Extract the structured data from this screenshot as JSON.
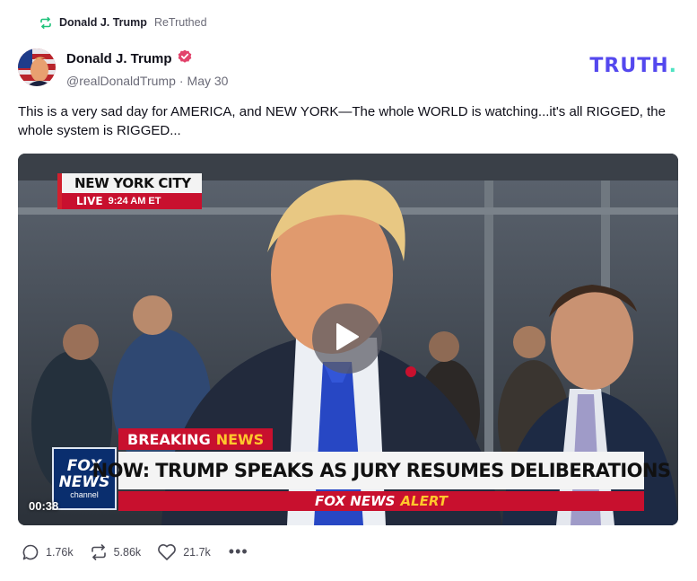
{
  "retruth": {
    "name": "Donald J. Trump",
    "label": "ReTruthed"
  },
  "post": {
    "author_name": "Donald J. Trump",
    "handle": "@realDonaldTrump",
    "separator": "·",
    "date": "May 30",
    "text": "This is a very sad day for AMERICA, and NEW YORK—The whole WORLD is watching...it's all RIGGED, the whole system is RIGGED..."
  },
  "brand": {
    "main": "TRUTH",
    "dot": "."
  },
  "video": {
    "duration": "00:38",
    "location_tag": "NEW YORK CITY",
    "live_label": "LIVE",
    "live_time": "9:24 AM ET",
    "breaking_a": "BREAKING",
    "breaking_b": "NEWS",
    "headline": "NOW: TRUMP SPEAKS AS JURY RESUMES DELIBERATIONS",
    "alert_a": "FOX NEWS",
    "alert_b": "ALERT",
    "logo_line1": "FOX",
    "logo_line2": "NEWS",
    "logo_line3": "channel"
  },
  "actions": {
    "replies": "1.76k",
    "retruths": "5.86k",
    "likes": "21.7k",
    "more": "•••"
  },
  "colors": {
    "brand": "#5448ee",
    "brand_dot": "#4fe3c2",
    "verified": "#e2436b",
    "retruth_icon": "#1ec27a",
    "fox_red": "#c8102e"
  }
}
